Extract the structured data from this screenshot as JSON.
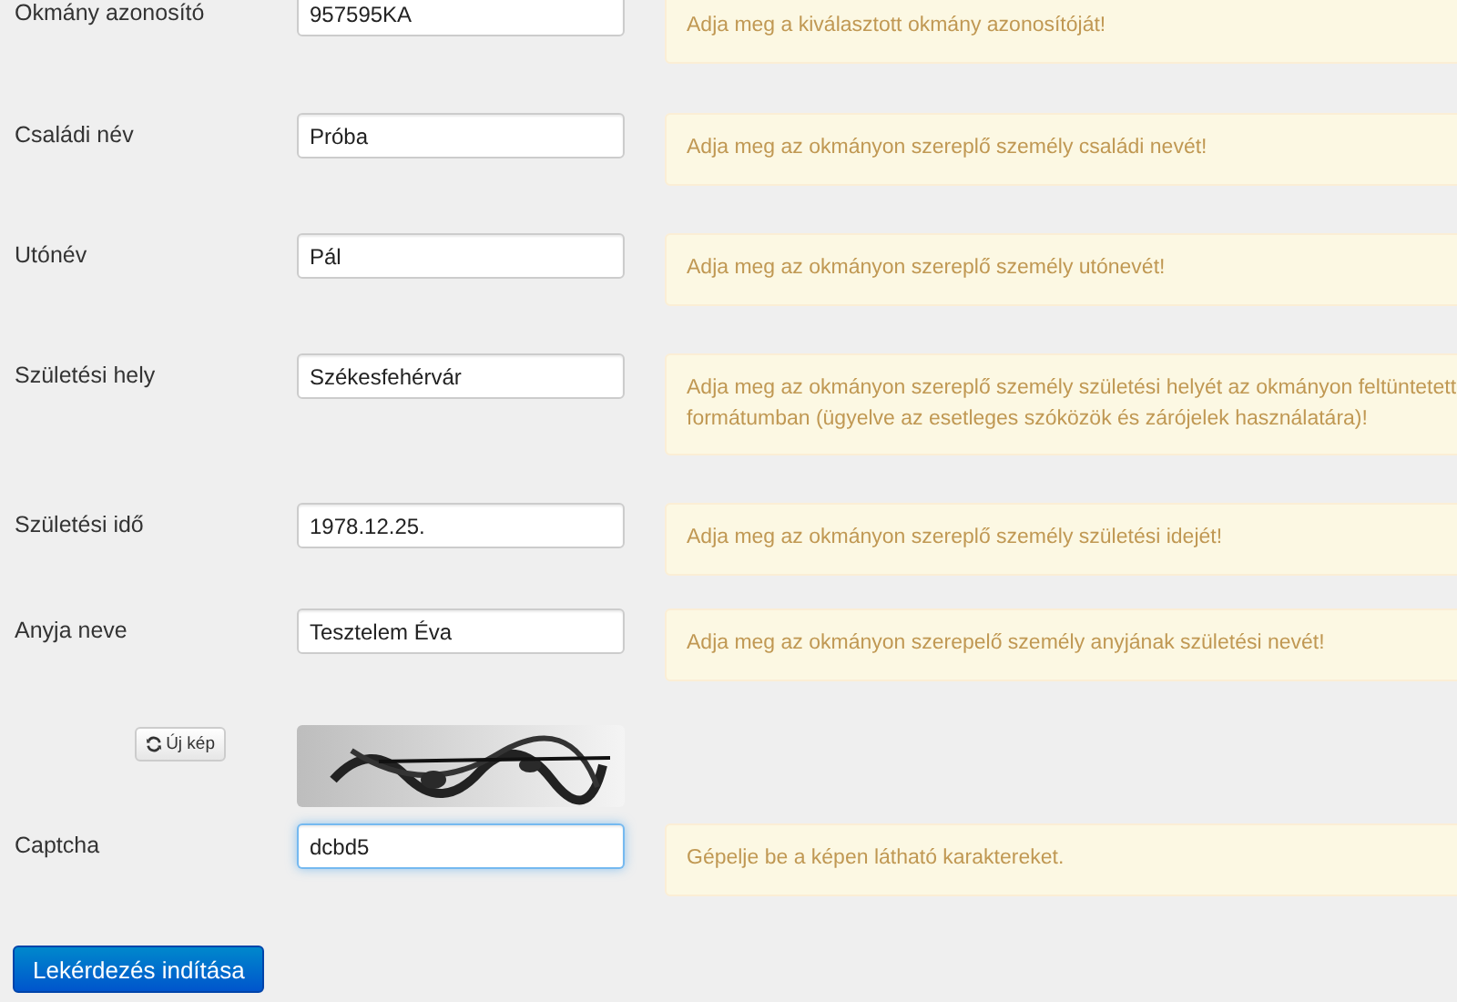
{
  "fields": [
    {
      "label": "Okmány azonosító",
      "value": "957595KA",
      "hint": "Adja meg a kiválasztott okmány azonosítóját!",
      "focused": false
    },
    {
      "label": "Családi név",
      "value": "Próba",
      "hint": "Adja meg az okmányon szereplő személy családi nevét!",
      "focused": false
    },
    {
      "label": "Utónév",
      "value": "Pál",
      "hint": "Adja meg az okmányon szereplő személy utónevét!",
      "focused": false
    },
    {
      "label": "Születési hely",
      "value": "Székesfehérvár",
      "hint": "Adja meg az okmányon szereplő személy születési helyét az okmányon feltüntetett formátumban (ügyelve az esetleges szóközök és zárójelek használatára)!",
      "focused": false
    },
    {
      "label": "Születési idő",
      "value": "1978.12.25.",
      "hint": "Adja meg az okmányon szereplő személy születési idejét!",
      "focused": false
    },
    {
      "label": "Anyja neve",
      "value": "Tesztelem Éva",
      "hint": "Adja meg az okmányon szerepelő személy anyjának születési nevét!",
      "focused": false
    }
  ],
  "captcha": {
    "refresh_button": "Új kép",
    "label": "Captcha",
    "value": "dcbd5",
    "hint": "Gépelje be a képen látható karaktereket.",
    "focused": true
  },
  "submit_button": "Lekérdezés indítása"
}
